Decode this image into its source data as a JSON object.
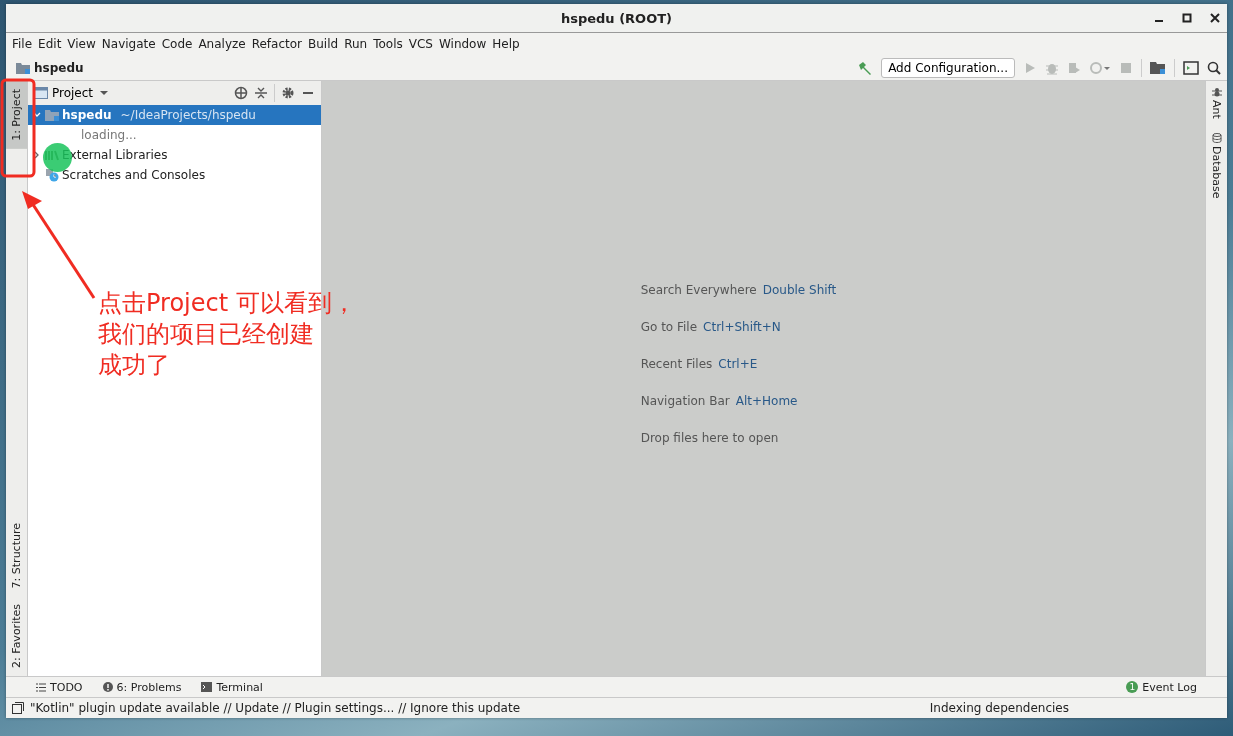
{
  "window": {
    "title": "hspedu (ROOT)"
  },
  "menu": [
    "File",
    "Edit",
    "View",
    "Navigate",
    "Code",
    "Analyze",
    "Refactor",
    "Build",
    "Run",
    "Tools",
    "VCS",
    "Window",
    "Help"
  ],
  "navigation": {
    "project": "hspedu",
    "run_config": "Add Configuration..."
  },
  "left_tabs_top": [
    {
      "label": "1: Project",
      "selected": true
    }
  ],
  "left_tabs_bottom": [
    {
      "label": "7: Structure",
      "selected": false
    },
    {
      "label": "2: Favorites",
      "selected": false
    }
  ],
  "project_panel": {
    "title": "Project",
    "tree": [
      {
        "label": "hspedu",
        "path": "~/IdeaProjects/hspedu",
        "kind": "module",
        "selected": true,
        "expanded": true,
        "children": [
          {
            "label": "loading...",
            "kind": "loading",
            "selected": false
          }
        ]
      },
      {
        "label": "External Libraries",
        "kind": "libraries",
        "selected": false,
        "expanded": false
      },
      {
        "label": "Scratches and Consoles",
        "kind": "scratches",
        "selected": false
      }
    ]
  },
  "editor_hints": [
    {
      "label": "Search Everywhere",
      "shortcut": "Double Shift"
    },
    {
      "label": "Go to File",
      "shortcut": "Ctrl+Shift+N"
    },
    {
      "label": "Recent Files",
      "shortcut": "Ctrl+E"
    },
    {
      "label": "Navigation Bar",
      "shortcut": "Alt+Home"
    },
    {
      "label": "Drop files here to open"
    }
  ],
  "right_tabs": [
    {
      "label": "Ant",
      "kind": "ant"
    },
    {
      "label": "Database",
      "kind": "database"
    }
  ],
  "tool_tabs": [
    {
      "label": "TODO",
      "kind": "todo"
    },
    {
      "label": "6: Problems",
      "kind": "problems"
    },
    {
      "label": "Terminal",
      "kind": "terminal"
    }
  ],
  "event_log": {
    "label": "Event Log",
    "count": "1"
  },
  "status_bar": {
    "message": "\"Kotlin\" plugin update available // Update // Plugin settings... // Ignore this update",
    "progress": "Indexing dependencies"
  },
  "annotation": {
    "lines": [
      "点击Project 可以看到，",
      "我们的项目已经创建",
      "成功了"
    ]
  }
}
